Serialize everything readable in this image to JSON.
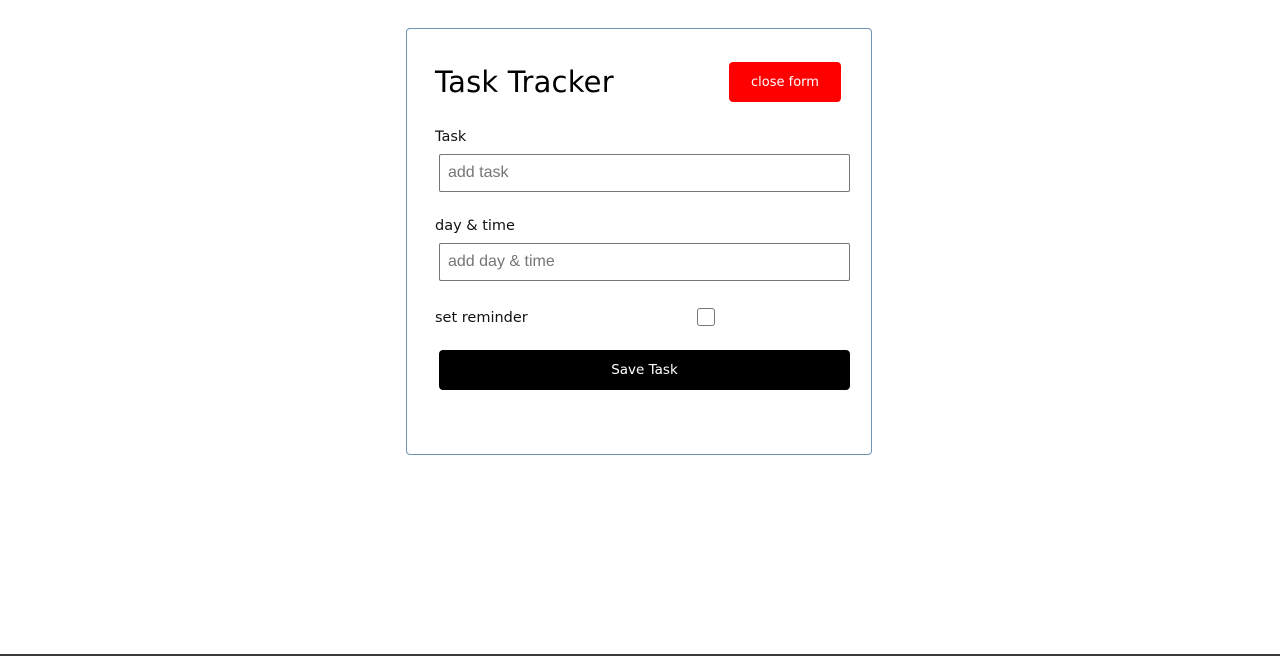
{
  "app": {
    "title": "Task Tracker"
  },
  "header": {
    "close_label": "close form"
  },
  "form": {
    "task_label": "Task",
    "task_placeholder": "add task",
    "task_value": "",
    "day_label": "day & time",
    "day_placeholder": "add day & time",
    "day_value": "",
    "reminder_label": "set reminder",
    "reminder_checked": false,
    "save_label": "Save Task"
  },
  "colors": {
    "close_button": "#ff0000",
    "save_button": "#000000",
    "card_border": "#6f93b6"
  }
}
